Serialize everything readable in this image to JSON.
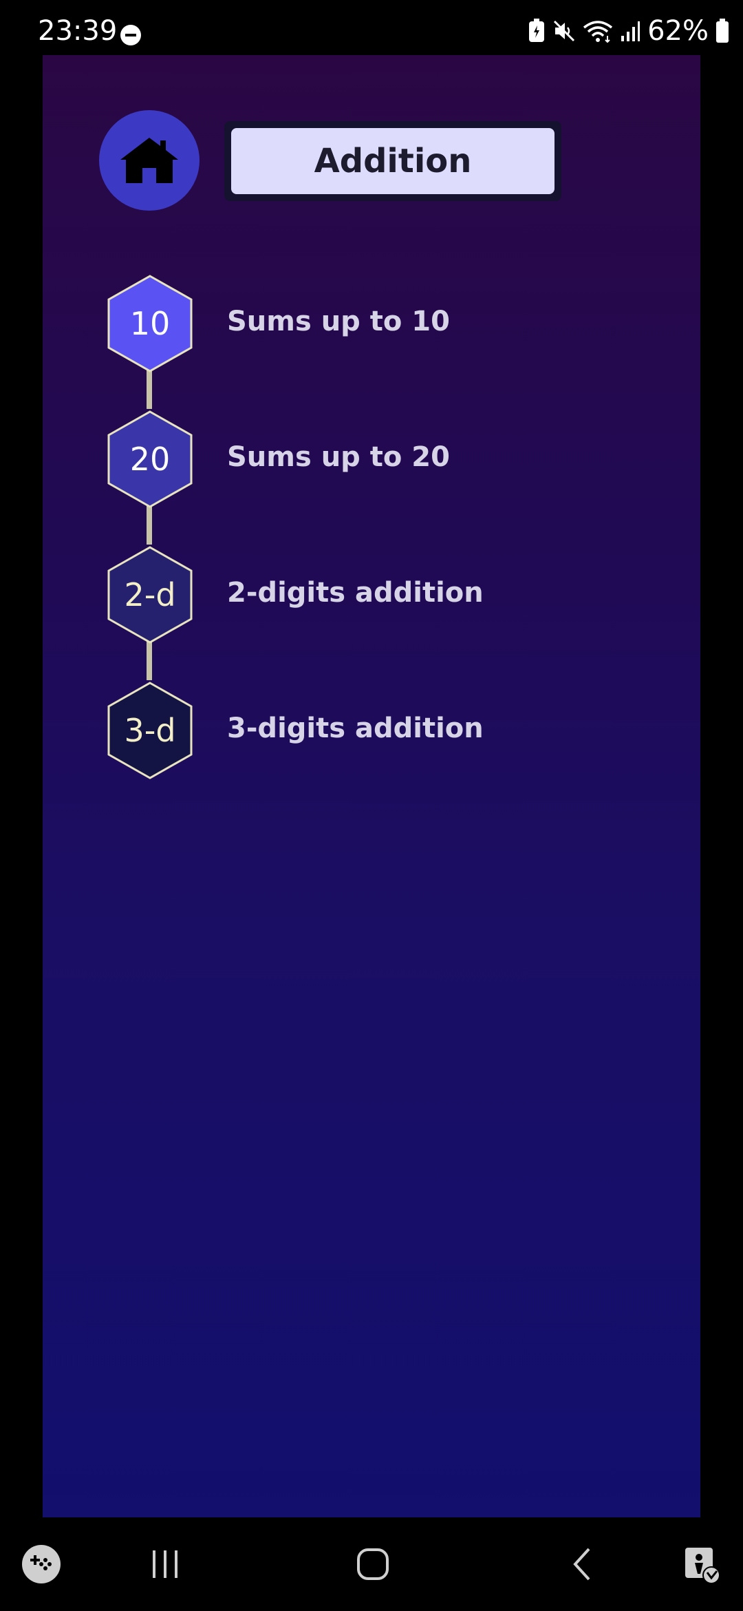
{
  "status_bar": {
    "time": "23:39",
    "battery": "62%",
    "icons": [
      "do-not-disturb-icon",
      "battery-saver-icon",
      "mute-icon",
      "wifi-icon",
      "signal-icon",
      "battery-icon"
    ]
  },
  "header": {
    "home_icon": "home-icon",
    "title": "Addition"
  },
  "levels": [
    {
      "badge": "10",
      "label": "Sums up to 10",
      "color": "#5a52f2"
    },
    {
      "badge": "20",
      "label": "Sums up to 20",
      "color": "#3a35a8"
    },
    {
      "badge": "2-d",
      "label": "2-digits addition",
      "color": "#25216e"
    },
    {
      "badge": "3-d",
      "label": "3-digits addition",
      "color": "#141444"
    }
  ],
  "colors": {
    "home_button": "#3c3ac4",
    "title_box": "#dedcfc",
    "connector": "#c8c4a8",
    "hex_border": "#e8e4c0",
    "text": "#d8d4e8"
  },
  "nav_bar": {
    "icons": [
      "game-launcher-icon",
      "recent-apps-icon",
      "home-nav-icon",
      "back-icon",
      "accessibility-icon"
    ]
  }
}
